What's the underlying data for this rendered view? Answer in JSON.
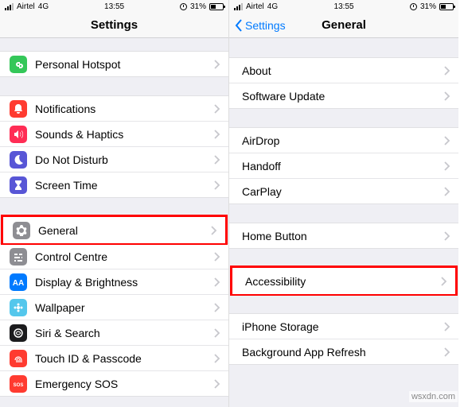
{
  "status": {
    "carrier": "Airtel",
    "net": "4G",
    "time": "13:55",
    "battery": "31%"
  },
  "left": {
    "title": "Settings",
    "rows": [
      {
        "id": "personal-hotspot",
        "label": "Personal Hotspot",
        "icon": "link-icon",
        "color": "#34c759"
      },
      {
        "id": "notifications",
        "label": "Notifications",
        "icon": "bell-icon",
        "color": "#ff3b30"
      },
      {
        "id": "sounds-haptics",
        "label": "Sounds & Haptics",
        "icon": "sound-icon",
        "color": "#ff2d55"
      },
      {
        "id": "do-not-disturb",
        "label": "Do Not Disturb",
        "icon": "moon-icon",
        "color": "#5856d6"
      },
      {
        "id": "screen-time",
        "label": "Screen Time",
        "icon": "hourglass-icon",
        "color": "#5856d6"
      },
      {
        "id": "general",
        "label": "General",
        "icon": "gear-icon",
        "color": "#8e8e93",
        "highlight": true
      },
      {
        "id": "control-centre",
        "label": "Control Centre",
        "icon": "sliders-icon",
        "color": "#8e8e93"
      },
      {
        "id": "display",
        "label": "Display & Brightness",
        "icon": "aa-icon",
        "color": "#007aff"
      },
      {
        "id": "wallpaper",
        "label": "Wallpaper",
        "icon": "flower-icon",
        "color": "#54c7ec"
      },
      {
        "id": "siri",
        "label": "Siri & Search",
        "icon": "siri-icon",
        "color": "#1c1c1e"
      },
      {
        "id": "touchid",
        "label": "Touch ID & Passcode",
        "icon": "fingerprint-icon",
        "color": "#ff3b30"
      },
      {
        "id": "emergency-sos",
        "label": "Emergency SOS",
        "icon": "sos-icon",
        "color": "#ff3b30"
      }
    ],
    "groups": [
      [
        0
      ],
      [
        1,
        2,
        3,
        4
      ],
      [
        5,
        6,
        7,
        8,
        9,
        10,
        11
      ]
    ]
  },
  "right": {
    "title": "General",
    "back": "Settings",
    "rows": [
      {
        "id": "about",
        "label": "About"
      },
      {
        "id": "software-update",
        "label": "Software Update"
      },
      {
        "id": "airdrop",
        "label": "AirDrop"
      },
      {
        "id": "handoff",
        "label": "Handoff"
      },
      {
        "id": "carplay",
        "label": "CarPlay"
      },
      {
        "id": "home-button",
        "label": "Home Button"
      },
      {
        "id": "accessibility",
        "label": "Accessibility",
        "highlight": true
      },
      {
        "id": "iphone-storage",
        "label": "iPhone Storage"
      },
      {
        "id": "bg-app-refresh",
        "label": "Background App Refresh"
      }
    ],
    "groups": [
      [
        0,
        1
      ],
      [
        2,
        3,
        4
      ],
      [
        5
      ],
      [
        6
      ],
      [
        7,
        8
      ]
    ]
  },
  "watermark": "wsxdn.com"
}
